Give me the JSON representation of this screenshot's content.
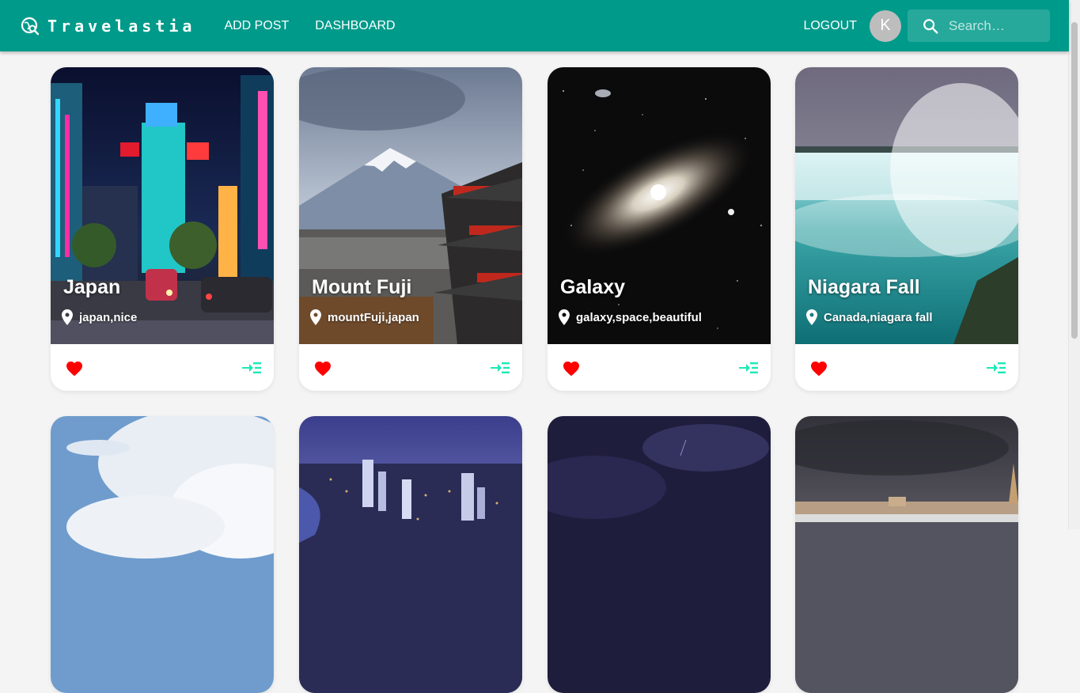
{
  "app": {
    "brand": "Travelastia",
    "nav": [
      "ADD POST",
      "DASHBOARD"
    ],
    "logout_label": "LOGOUT",
    "avatar_letter": "K",
    "search_placeholder": "Search…"
  },
  "colors": {
    "appbar": "#009a8a",
    "like": "#ff0000",
    "open": "#1de9b6"
  },
  "posts": [
    {
      "title": "Japan",
      "tags": "japan,nice",
      "image": "night-city-street-photo"
    },
    {
      "title": "Mount Fuji",
      "tags": "mountFuji,japan",
      "image": "mountain-pagoda-photo"
    },
    {
      "title": "Galaxy",
      "tags": "galaxy,space,beautiful",
      "image": "galaxy-photo"
    },
    {
      "title": "Niagara Fall",
      "tags": "Canada,niagara fall",
      "image": "waterfall-photo"
    },
    {
      "title": "",
      "tags": "",
      "image": "clouds-sky-photo"
    },
    {
      "title": "",
      "tags": "",
      "image": "city-river-night-photo"
    },
    {
      "title": "",
      "tags": "",
      "image": "stormy-night-sky-photo"
    },
    {
      "title": "",
      "tags": "",
      "image": "bridge-storm-photo"
    }
  ]
}
